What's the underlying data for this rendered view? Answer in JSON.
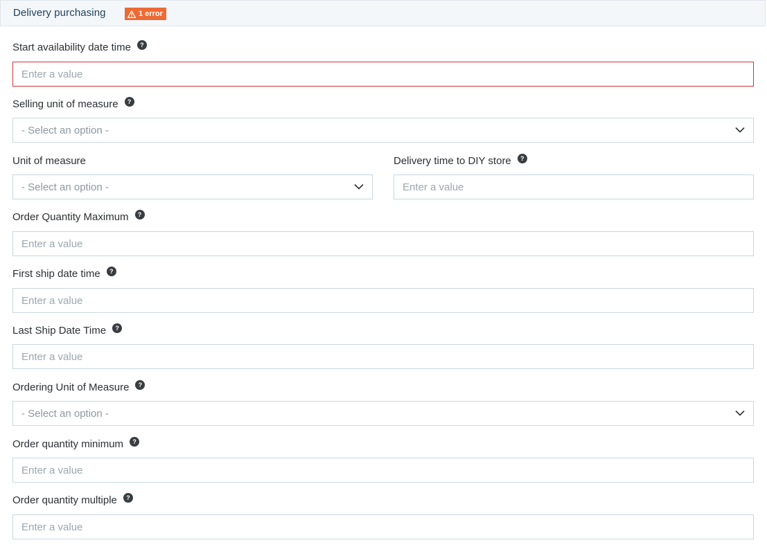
{
  "section": {
    "title": "Delivery purchasing",
    "error_badge": "1 error",
    "accent_error": "#ee6a34"
  },
  "fields": {
    "start_availability": {
      "label": "Start availability date time",
      "placeholder": "Enter a value",
      "help_icon": "?"
    },
    "selling_uom": {
      "label": "Selling unit of measure",
      "selected": "- Select an option -",
      "help_icon": "?"
    },
    "unit_of_measure": {
      "label": "Unit of measure",
      "selected": "- Select an option -"
    },
    "delivery_time_diy": {
      "label": "Delivery time to DIY store",
      "placeholder": "Enter a value",
      "help_icon": "?"
    },
    "order_qty_max": {
      "label": "Order Quantity Maximum",
      "placeholder": "Enter a value",
      "help_icon": "?"
    },
    "first_ship": {
      "label": "First ship date time",
      "placeholder": "Enter a value",
      "help_icon": "?"
    },
    "last_ship": {
      "label": "Last Ship Date Time",
      "placeholder": "Enter a value",
      "help_icon": "?"
    },
    "ordering_uom": {
      "label": "Ordering Unit of Measure",
      "selected": "- Select an option -",
      "help_icon": "?"
    },
    "order_qty_min": {
      "label": "Order quantity minimum",
      "placeholder": "Enter a value",
      "help_icon": "?"
    },
    "order_qty_multiple": {
      "label": "Order quantity multiple",
      "placeholder": "Enter a value",
      "help_icon": "?"
    }
  }
}
